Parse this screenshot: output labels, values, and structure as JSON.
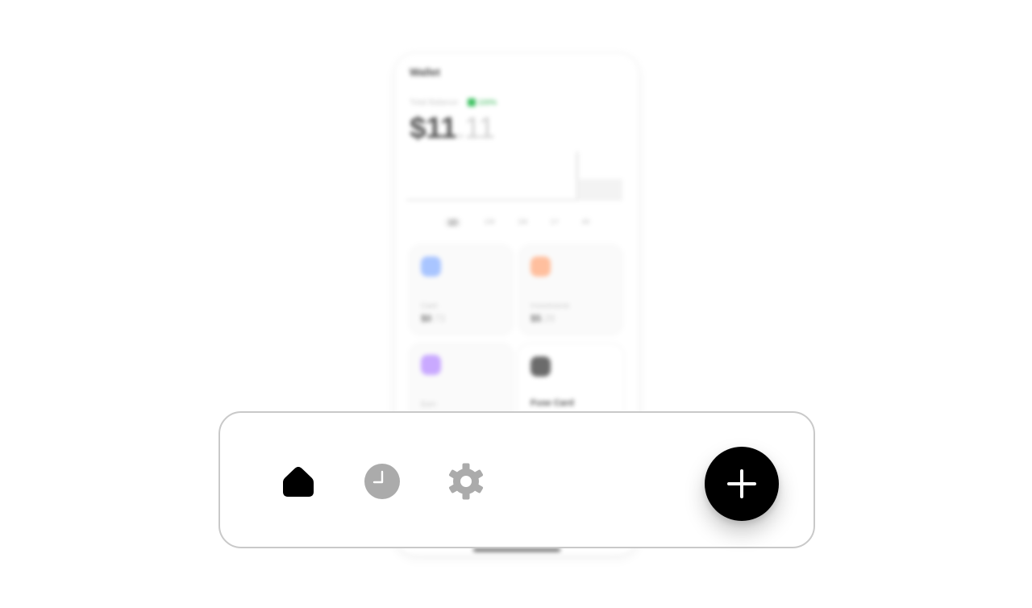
{
  "wallet": {
    "title": "Wallet",
    "balance_label": "Total Balance",
    "change_pct": "100%",
    "balance_whole": "$11",
    "balance_cents": ".11",
    "ranges": [
      "1D",
      "1W",
      "1M",
      "1Y",
      "All"
    ],
    "active_range": "1D",
    "accent_green": "#3cc060"
  },
  "cards": [
    {
      "label": "Cash",
      "value_whole": "$0",
      "value_cents": ".73",
      "icon": "cash-icon",
      "color": "#a9c5ff"
    },
    {
      "label": "Investments",
      "value_whole": "$5",
      "value_cents": ".29",
      "icon": "investments-icon",
      "color": "#ffbf9e"
    },
    {
      "label": "Earn",
      "icon": "earn-icon",
      "color": "#c9a9ff"
    },
    {
      "label": "Fuse Card",
      "icon": "fuse-card-icon",
      "color": "#6b6b6b"
    }
  ],
  "tabbar": {
    "tabs": [
      {
        "id": "home",
        "icon": "home-icon",
        "active": true
      },
      {
        "id": "history",
        "icon": "clock-icon",
        "active": false
      },
      {
        "id": "settings",
        "icon": "gear-icon",
        "active": false
      }
    ],
    "add_icon": "plus-icon",
    "active_color": "#000000",
    "inactive_color": "#ababab"
  }
}
